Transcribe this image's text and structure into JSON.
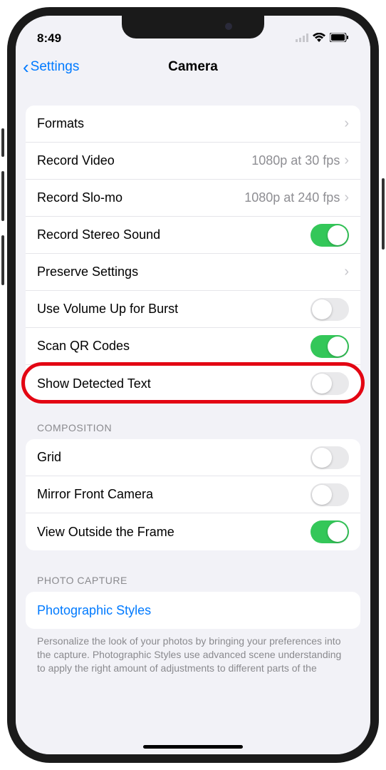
{
  "status": {
    "time": "8:49"
  },
  "nav": {
    "back_label": "Settings",
    "title": "Camera"
  },
  "group1": {
    "formats": "Formats",
    "record_video": "Record Video",
    "record_video_detail": "1080p at 30 fps",
    "record_slomo": "Record Slo-mo",
    "record_slomo_detail": "1080p at 240 fps",
    "record_stereo": "Record Stereo Sound",
    "preserve_settings": "Preserve Settings",
    "volume_up_burst": "Use Volume Up for Burst",
    "scan_qr": "Scan QR Codes",
    "show_detected_text": "Show Detected Text"
  },
  "sections": {
    "composition": "COMPOSITION",
    "photo_capture": "PHOTO CAPTURE"
  },
  "group2": {
    "grid": "Grid",
    "mirror_front": "Mirror Front Camera",
    "view_outside_frame": "View Outside the Frame"
  },
  "group3": {
    "photographic_styles": "Photographic Styles"
  },
  "footer": "Personalize the look of your photos by bringing your preferences into the capture. Photographic Styles use advanced scene understanding to apply the right amount of adjustments to different parts of the",
  "toggles": {
    "record_stereo": true,
    "volume_up_burst": false,
    "scan_qr": true,
    "show_detected_text": false,
    "grid": false,
    "mirror_front": false,
    "view_outside_frame": true
  }
}
